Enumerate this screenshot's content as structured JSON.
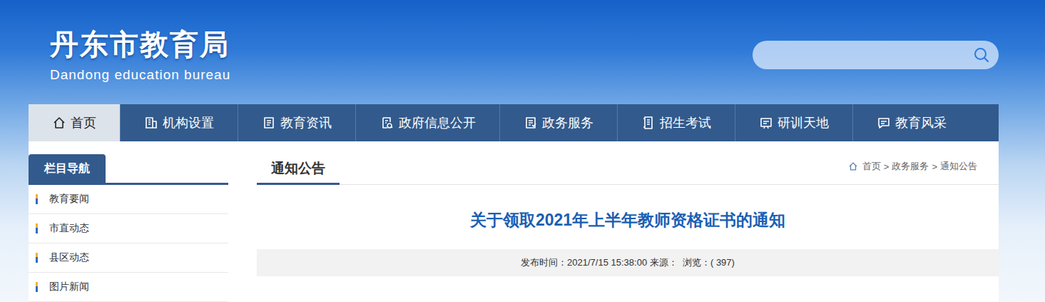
{
  "logo": {
    "title": "丹东市教育局",
    "subtitle": "Dandong education bureau"
  },
  "nav": [
    {
      "label": "首页",
      "selected": true
    },
    {
      "label": "机构设置",
      "selected": false
    },
    {
      "label": "教育资讯",
      "selected": false
    },
    {
      "label": "政府信息公开",
      "selected": false
    },
    {
      "label": "政务服务",
      "selected": false
    },
    {
      "label": "招生考试",
      "selected": false
    },
    {
      "label": "研训天地",
      "selected": false
    },
    {
      "label": "教育风采",
      "selected": false
    }
  ],
  "sidebar": {
    "title": "栏目导航",
    "items": [
      "教育要闻",
      "市直动态",
      "县区动态",
      "图片新闻"
    ]
  },
  "section": {
    "title": "通知公告"
  },
  "breadcrumb": {
    "items": [
      "首页",
      "政务服务",
      "通知公告"
    ],
    "separator": ">"
  },
  "article": {
    "title": "关于领取2021年上半年教师资格证书的通知",
    "meta": "发布时间：2021/7/15 15:38:00 来源：  浏览：( 397)"
  }
}
